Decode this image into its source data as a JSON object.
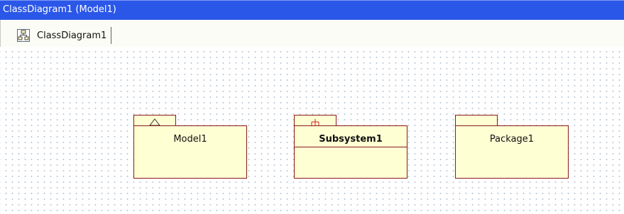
{
  "window": {
    "title": "ClassDiagram1 (Model1)"
  },
  "tabs": [
    {
      "label": "ClassDiagram1",
      "icon": "class-diagram-icon"
    }
  ],
  "diagram": {
    "elements": [
      {
        "name": "Model1",
        "kind": "model",
        "icon": "model-triangle-icon",
        "bold": false
      },
      {
        "name": "Subsystem1",
        "kind": "subsystem",
        "icon": "subsystem-fork-icon",
        "bold": true
      },
      {
        "name": "Package1",
        "kind": "package",
        "icon": "",
        "bold": false
      }
    ]
  },
  "colors": {
    "titlebar": "#2b57e8",
    "package_fill": "#ffffd4",
    "package_border": "#8b1a1a",
    "grid_dot": "#b9c7d4"
  }
}
